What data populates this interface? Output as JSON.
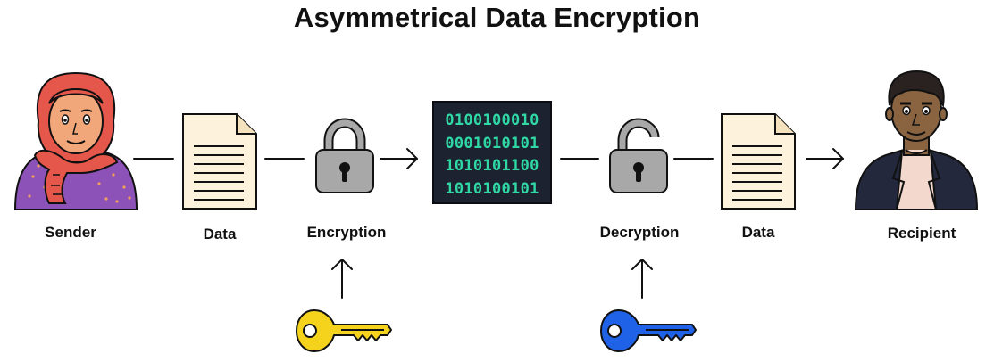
{
  "title": "Asymmetrical Data Encryption",
  "labels": {
    "sender": "Sender",
    "data_in": "Data",
    "encryption": "Encryption",
    "decryption": "Decryption",
    "data_out": "Data",
    "recipient": "Recipient"
  },
  "ciphertext": [
    "0100100010",
    "0001010101",
    "1010101100",
    "1010100101"
  ],
  "colors": {
    "public_key": "#f5d31c",
    "private_key": "#1f62e8",
    "cipher_text": "#2fd8a5",
    "cipher_bg": "#1c2230",
    "document": "#fdf3dc",
    "lock": "#a8a8a8"
  },
  "icons": [
    "sender-person-icon",
    "document-icon",
    "lock-closed-icon",
    "lock-open-icon",
    "key-icon",
    "recipient-person-icon",
    "arrow-right-icon",
    "arrow-up-icon"
  ]
}
